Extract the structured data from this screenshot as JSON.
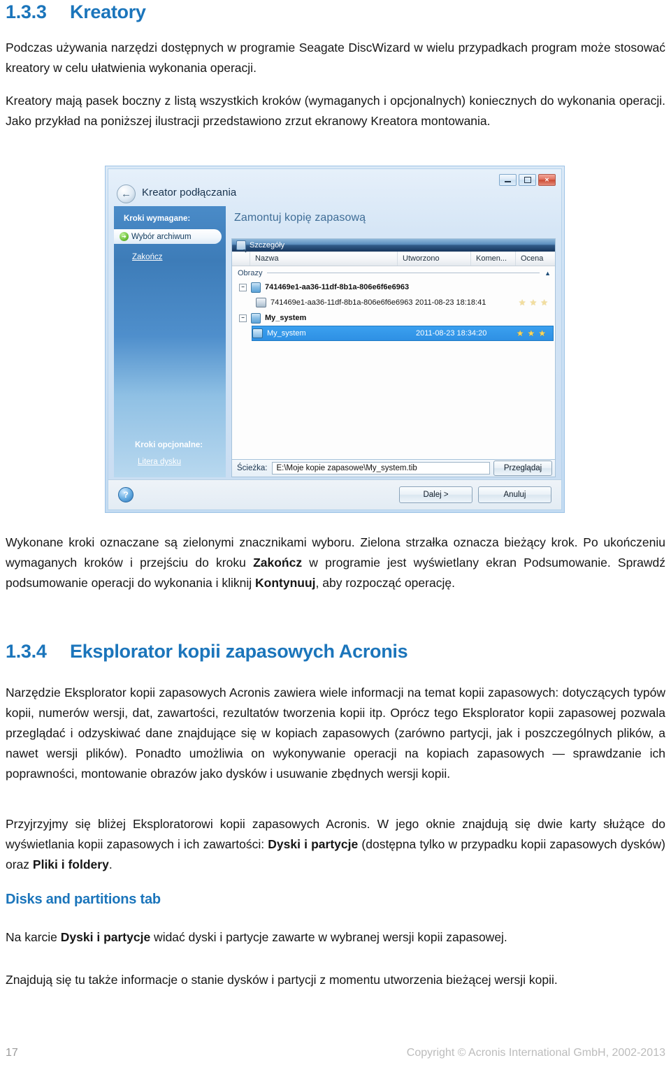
{
  "section": {
    "number": "1.3.3",
    "title": "Kreatory",
    "paragraphs": [
      "Podczas używania narzędzi dostępnych w programie Seagate DiscWizard w wielu przypadkach program może stosować kreatory w celu ułatwienia wykonania operacji.",
      "Kreatory mają pasek boczny z listą wszystkich kroków (wymaganych i opcjonalnych) koniecznych do wykonania operacji. Jako przykład na poniższej ilustracji przedstawiono zrzut ekranowy Kreatora montowania."
    ]
  },
  "screenshot": {
    "window_title": "Kreator podłączania",
    "window_buttons": {
      "minimize": "minimize-icon",
      "maximize": "maximize-icon",
      "close": "✕"
    },
    "back_arrow": "←",
    "sidebar": {
      "required_header": "Kroki wymagane:",
      "steps": [
        {
          "label": "Wybór archiwum",
          "state": "current"
        },
        {
          "label": "Zakończ",
          "state": "pending"
        }
      ],
      "optional_header": "Kroki opcjonalne:",
      "optional_steps": [
        {
          "label": "Litera dysku"
        }
      ]
    },
    "page_heading": "Zamontuj kopię zapasową",
    "panel_caption": "Szczegóły",
    "columns": [
      "",
      "Nazwa",
      "Utworzono",
      "Komen...",
      "Ocena"
    ],
    "group_label": "Obrazy",
    "group_collapse_icon": "▲",
    "rows": [
      {
        "level": 0,
        "name": "741469e1-aa36-11df-8b1a-806e6f6e6963",
        "created": "",
        "rating": 0,
        "selected": false,
        "twisty": "−"
      },
      {
        "level": 1,
        "name": "741469e1-aa36-11df-8b1a-806e6f6e6963",
        "created": "2011-08-23 18:18:41",
        "rating": 0,
        "selected": false,
        "twisty": ""
      },
      {
        "level": 0,
        "name": "My_system",
        "created": "",
        "rating": 0,
        "selected": false,
        "twisty": "−"
      },
      {
        "level": 1,
        "name": "My_system",
        "created": "2011-08-23 18:34:20",
        "rating": 3,
        "selected": true,
        "twisty": ""
      }
    ],
    "scrollbar": {
      "left_arrow": "◀",
      "right_arrow": "▶",
      "grip": "|||"
    },
    "path": {
      "label": "Ścieżka:",
      "value": "E:\\Moje kopie zapasowe\\My_system.tib",
      "browse_label": "Przeglądaj"
    },
    "footer": {
      "help_label": "?",
      "next_label": "Dalej >",
      "next_accel": "D",
      "cancel_label": "Anuluj",
      "cancel_accel": "A"
    }
  },
  "after_shot": {
    "p1_part1": "Wykonane kroki oznaczane są zielonymi znacznikami wyboru. Zielona strzałka oznacza bieżący krok. Po ukończeniu wymaganych kroków i przejściu do kroku ",
    "p1_bold1": "Zakończ",
    "p1_part2": " w programie jest wyświetlany ekran Podsumowanie. Sprawdź podsumowanie operacji do wykonania i kliknij ",
    "p1_bold2": "Kontynuuj",
    "p1_part3": ", aby rozpocząć operację."
  },
  "section2": {
    "number": "1.3.4",
    "title": "Eksplorator kopii zapasowych Acronis",
    "p1": "Narzędzie Eksplorator kopii zapasowych Acronis zawiera wiele informacji na temat kopii zapasowych: dotyczących typów kopii, numerów wersji, dat, zawartości, rezultatów tworzenia kopii itp. Oprócz tego Eksplorator kopii zapasowej pozwala przeglądać i odzyskiwać dane znajdujące się w kopiach zapasowych (zarówno partycji, jak i poszczególnych plików, a nawet wersji plików). Ponadto umożliwia on wykonywanie operacji na kopiach zapasowych — sprawdzanie ich poprawności, montowanie obrazów jako dysków i usuwanie zbędnych wersji kopii.",
    "p2_part1": "Przyjrzyjmy się bliżej Eksploratorowi kopii zapasowych Acronis. W jego oknie znajdują się dwie karty służące do wyświetlania kopii zapasowych i ich zawartości: ",
    "p2_bold1": "Dyski i partycje",
    "p2_part2": " (dostępna tylko w przypadku kopii zapasowych dysków) oraz ",
    "p2_bold2": "Pliki i foldery",
    "p2_part3": "."
  },
  "subsection": {
    "title": "Disks and partitions tab",
    "p1_part1": "Na karcie ",
    "p1_bold1": "Dyski i partycje",
    "p1_part2": " widać dyski i partycje zawarte w wybranej wersji kopii zapasowej.",
    "p2": "Znajdują się tu także informacje o stanie dysków i partycji z momentu utworzenia bieżącej wersji kopii."
  },
  "page_footer": {
    "page_number": "17",
    "copyright": "Copyright © Acronis International GmbH, 2002-2013"
  },
  "colors": {
    "heading": "#1b75bb",
    "body": "#161616",
    "footer": "#bcbcbc"
  }
}
